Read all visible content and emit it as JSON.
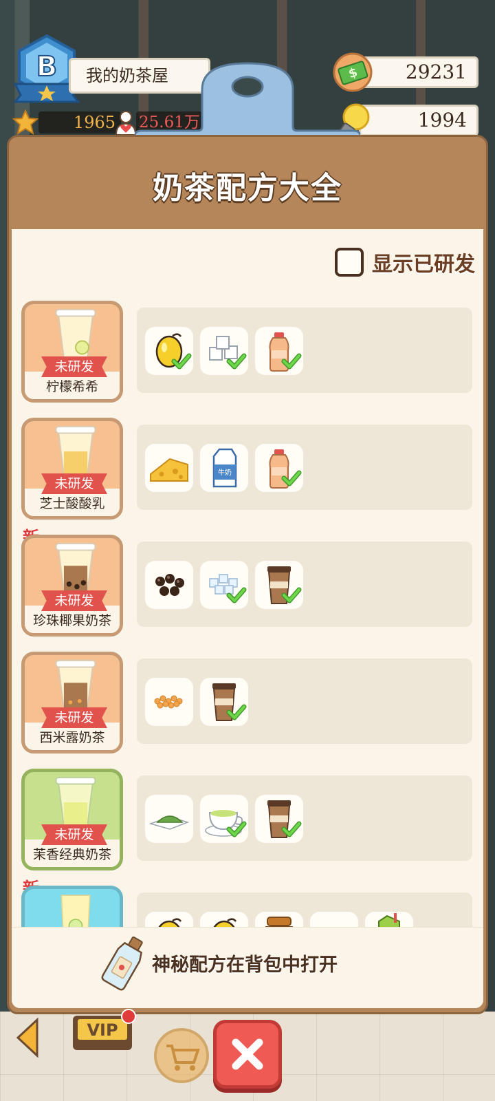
{
  "hud": {
    "rank_letter": "B",
    "shop_name": "我的奶茶屋",
    "stars": "1965",
    "fans": "25.61万",
    "money": "29231",
    "ideas": "1994"
  },
  "panel": {
    "title": "奶茶配方大全",
    "show_developed_label": "显示已研发",
    "show_developed_checked": false,
    "status_label": "未研发",
    "new_label": "新",
    "footer_text": "神秘配方在背包中打开"
  },
  "recipes": [
    {
      "name": "柠檬希希",
      "status": "未研发",
      "theme": "orange",
      "is_new": false,
      "ingredients": [
        {
          "icon": "lemon-icon",
          "owned": true
        },
        {
          "icon": "sugar-cubes-icon",
          "owned": true
        },
        {
          "icon": "yogurt-bottle-icon",
          "owned": true
        }
      ]
    },
    {
      "name": "芝士酸酸乳",
      "status": "未研发",
      "theme": "orange",
      "is_new": false,
      "ingredients": [
        {
          "icon": "cheese-icon",
          "owned": false
        },
        {
          "icon": "milk-carton-icon",
          "owned": false,
          "label": "牛奶"
        },
        {
          "icon": "yogurt-bottle-icon",
          "owned": true
        }
      ]
    },
    {
      "name": "珍珠椰果奶茶",
      "status": "未研发",
      "theme": "orange",
      "is_new": true,
      "ingredients": [
        {
          "icon": "tapioca-pearls-icon",
          "owned": false
        },
        {
          "icon": "coconut-jelly-icon",
          "owned": true
        },
        {
          "icon": "milk-tea-cup-icon",
          "owned": true
        }
      ]
    },
    {
      "name": "西米露奶茶",
      "status": "未研发",
      "theme": "orange",
      "is_new": false,
      "ingredients": [
        {
          "icon": "sago-icon",
          "owned": false
        },
        {
          "icon": "milk-tea-cup-icon",
          "owned": true
        }
      ]
    },
    {
      "name": "茉香经典奶茶",
      "status": "未研发",
      "theme": "green",
      "is_new": false,
      "ingredients": [
        {
          "icon": "matcha-powder-icon",
          "owned": false
        },
        {
          "icon": "green-tea-cup-icon",
          "owned": true
        },
        {
          "icon": "milk-tea-cup-icon",
          "owned": true
        }
      ]
    },
    {
      "name": "",
      "status": "",
      "theme": "blue",
      "is_new": true,
      "ingredients": [
        {
          "icon": "lemon-icon",
          "owned": false
        },
        {
          "icon": "lemon-icon",
          "owned": false
        },
        {
          "icon": "honey-jar-icon",
          "owned": false
        },
        {
          "icon": "green-tea-cup-icon",
          "owned": false
        },
        {
          "icon": "juice-box-icon",
          "owned": false
        }
      ]
    }
  ],
  "bottom_bar": {
    "vip_label": "VIP"
  },
  "colors": {
    "panel_brown": "#b5865a",
    "panel_cream": "#faf5e8",
    "ribbon_red": "#e0524b",
    "close_red": "#ef5a55",
    "check_green": "#5cc23a"
  }
}
